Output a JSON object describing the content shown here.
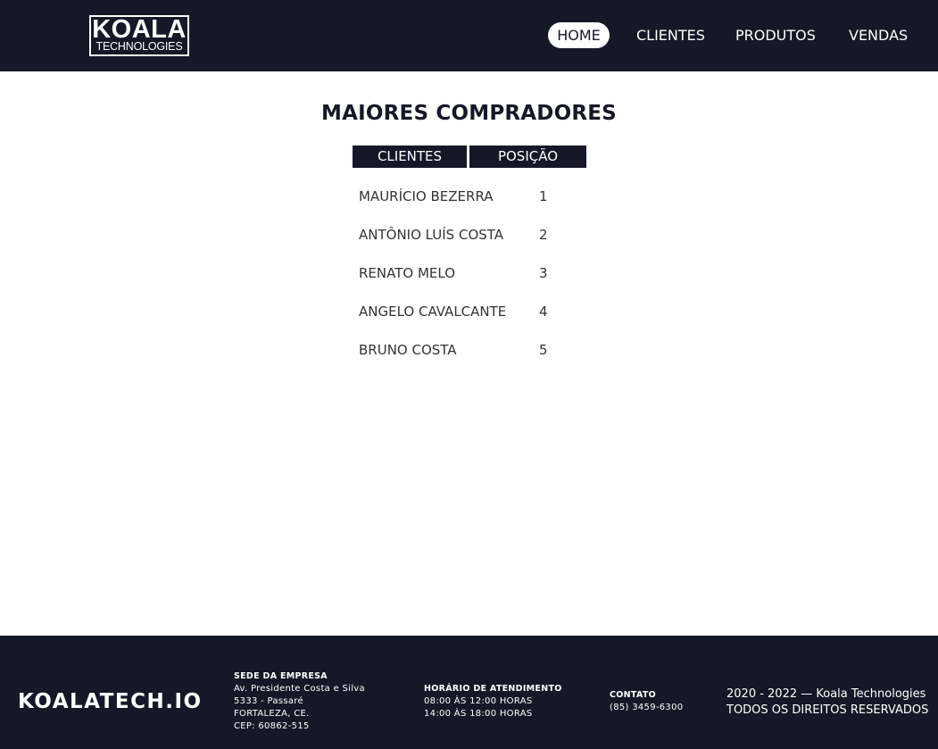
{
  "header": {
    "logo_main": "KOALA",
    "logo_sub": "TECHNOLOGIES",
    "nav": [
      "HOME",
      "CLIENTES",
      "PRODUTOS",
      "VENDAS"
    ]
  },
  "main": {
    "title": "MAIORES COMPRADORES",
    "columns": [
      "CLIENTES",
      "POSIÇÃO"
    ],
    "rows": [
      {
        "name": "MAURÍCIO BEZERRA",
        "position": "1"
      },
      {
        "name": "ANTÔNIO LUÍS COSTA",
        "position": "2"
      },
      {
        "name": "RENATO MELO",
        "position": "3"
      },
      {
        "name": "ANGELO CAVALCANTE",
        "position": "4"
      },
      {
        "name": "BRUNO COSTA",
        "position": "5"
      }
    ]
  },
  "footer": {
    "brand": "KOALATECH.IO",
    "sede": {
      "title": "SEDE DA EMPRESA",
      "lines": [
        "Av. Presidente Costa e Silva",
        "5333 - Passaré",
        "FORTALEZA, CE.",
        "CEP: 60862-515"
      ]
    },
    "horario": {
      "title": "HORÁRIO DE ATENDIMENTO",
      "lines": [
        "08:00 ÀS 12:00 HORAS",
        "14:00 ÀS 18:00 HORAS"
      ]
    },
    "contato": {
      "title": "CONTATO",
      "lines": [
        "(85) 3459-6300"
      ]
    },
    "copyright": [
      "2020 - 2022 — Koala Technologies",
      "TODOS OS DIREITOS RESERVADOS"
    ]
  },
  "colors": {
    "dark": "#161827",
    "white": "#ffffff"
  }
}
